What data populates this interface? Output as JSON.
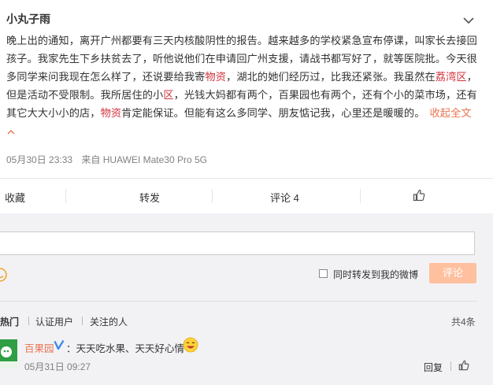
{
  "post": {
    "author": "小丸子雨",
    "segments": [
      {
        "text": "晚上出的通知，离开广州都要有三天内核酸阴性的报告。越来越多的学校紧急宣布停课，叫家长去接回孩子。我家先生下乡扶贫去了，听他说他们在申请回广州支援，请战书都写好了，就等医院批。今天很多同学来问我现在怎么样了，还说要给我寄",
        "hl": false
      },
      {
        "text": "物资",
        "hl": true
      },
      {
        "text": "，湖北的她们经历过，比我还紧张。我虽然在",
        "hl": false
      },
      {
        "text": "荔湾区",
        "hl": true
      },
      {
        "text": "，但是活动不受限制。我所居住的小",
        "hl": false
      },
      {
        "text": "区",
        "hl": true
      },
      {
        "text": "，光钱大妈都有两个，百果园也有两个，还有个小的菜市场，还有其它大大小小的店，",
        "hl": false
      },
      {
        "text": "物资",
        "hl": true
      },
      {
        "text": "肯定能保证。但能有这么多同学、朋友惦记我，心里还是暖暖的。",
        "hl": false
      }
    ],
    "collapse_label": "收起全文",
    "time": "05月30日 23:33",
    "source": "来自 HUAWEI Mate30 Pro 5G"
  },
  "actions": {
    "favorite": "收藏",
    "repost": "转发",
    "comment": "评论 4"
  },
  "composer": {
    "repost_checkbox_label": "同时转发到我的微博",
    "submit_label": "评论"
  },
  "filters": {
    "hot": "热门",
    "verified": "认证用户",
    "following": "关注的人",
    "total": "共4条"
  },
  "comment": {
    "user": "百果园",
    "text": "：天天吃水果、天天好心情",
    "time": "05月31日 09:27",
    "reply_label": "回复"
  },
  "colors": {
    "link": "#eb7350",
    "highlight": "#d2323c",
    "submit_disabled": "#ffc09f",
    "verified_badge": "#3c8ce7"
  }
}
